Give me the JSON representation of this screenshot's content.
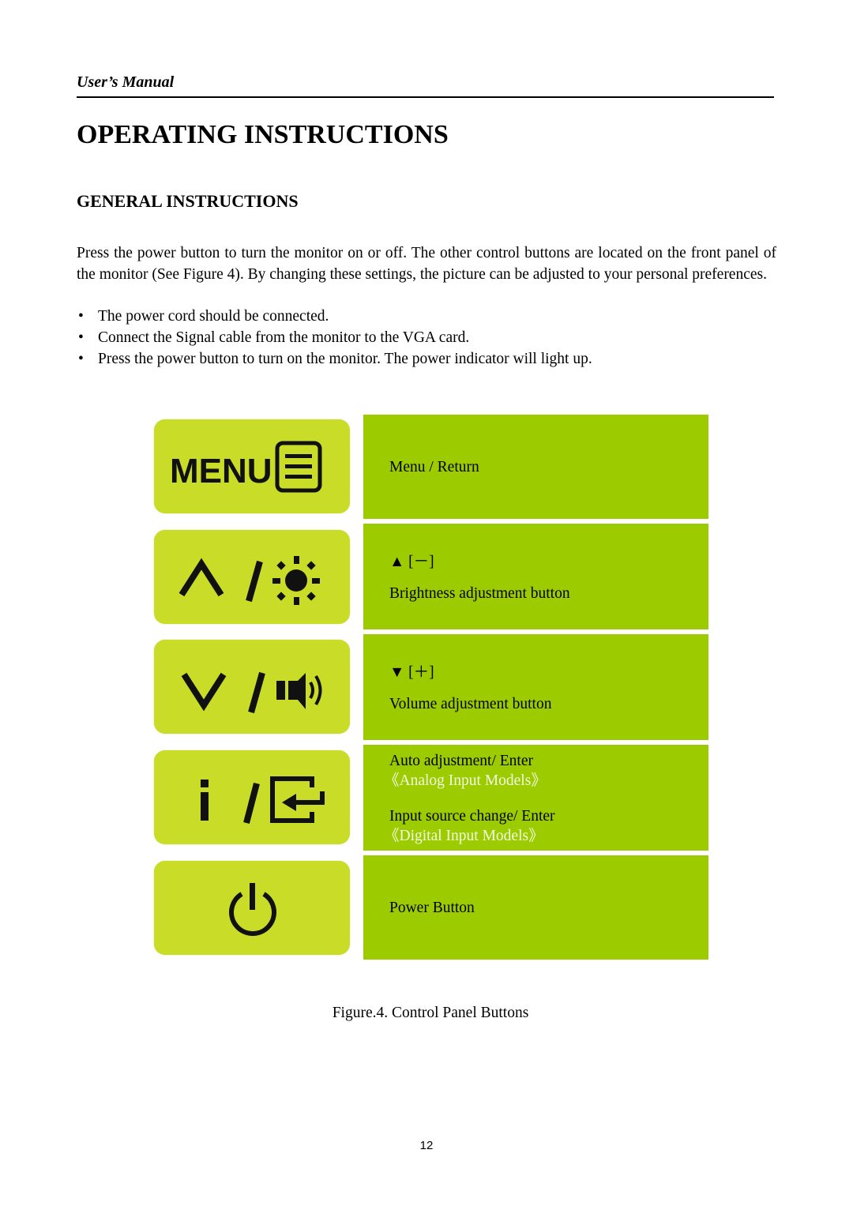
{
  "header": {
    "manual_title": "User’s Manual"
  },
  "page_title": "OPERATING INSTRUCTIONS",
  "section_title": "GENERAL INSTRUCTIONS",
  "intro_paragraph": "Press the power button to turn the monitor on or off. The other control buttons are located on the front panel of the monitor (See Figure 4). By changing these settings, the picture can be adjusted to your personal preferences.",
  "bullets": [
    "The power cord should be connected.",
    "Connect the Signal cable from the monitor to the VGA card.",
    "Press the power button to turn on the monitor. The power indicator will light up."
  ],
  "bullet_glyph": "•",
  "colors": {
    "icon_button_bg": "#c8dc28",
    "description_bg": "#9ccc00",
    "model_note_text": "#f3f8e0"
  },
  "control_buttons": [
    {
      "icon": "menu-icon",
      "icon_label": "MENU",
      "lines": [
        "Menu / Return"
      ]
    },
    {
      "icon": "up-brightness-icon",
      "lines": [
        "▲ [－]",
        "Brightness adjustment button"
      ]
    },
    {
      "icon": "down-volume-icon",
      "lines": [
        "▼ [＋]",
        "Volume adjustment button"
      ]
    },
    {
      "icon": "info-input-icon",
      "lines": [
        "Auto adjustment/ Enter",
        "《Analog Input Models》",
        "Input source change/ Enter",
        "《Digital Input Models》"
      ]
    },
    {
      "icon": "power-icon",
      "lines": [
        "Power Button"
      ]
    }
  ],
  "figure_caption": "Figure.4. Control Panel Buttons",
  "page_number": "12"
}
